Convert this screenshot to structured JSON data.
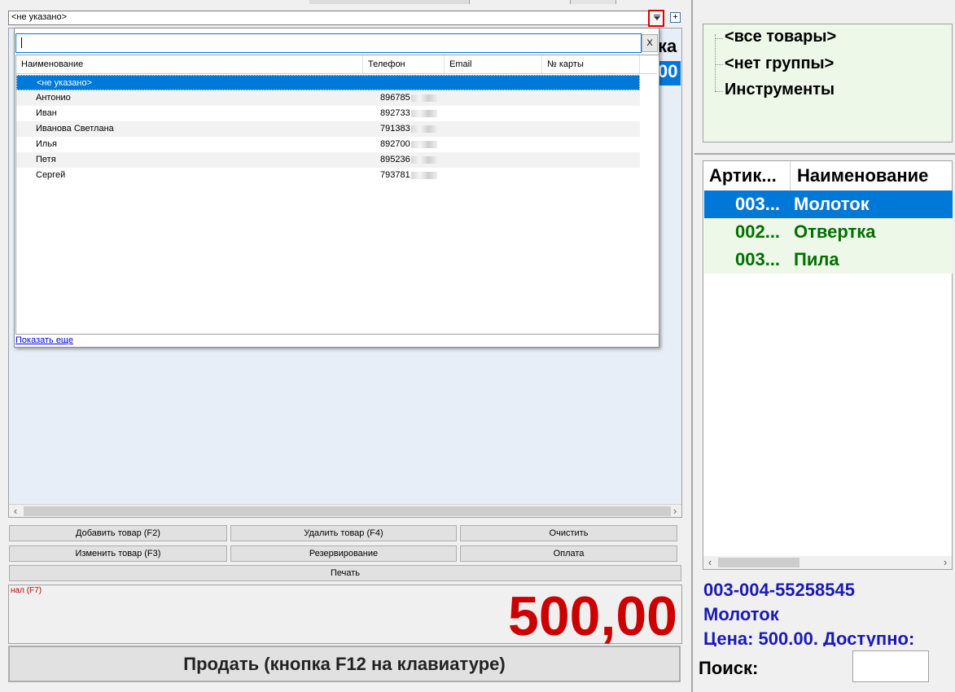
{
  "customer_combo": {
    "value": "<не указано>",
    "add_label": "+"
  },
  "cart_behind": {
    "header_fragment": "ка",
    "row_fragment": "00"
  },
  "popup": {
    "close_label": "X",
    "columns": [
      "Наименование",
      "Телефон",
      "Email",
      "№ карты"
    ],
    "rows": [
      {
        "name": "<не указано>",
        "phone": ""
      },
      {
        "name": "Антонио",
        "phone": "896785"
      },
      {
        "name": "Иван",
        "phone": "892733"
      },
      {
        "name": "Иванова Светлана",
        "phone": "791383"
      },
      {
        "name": "Илья",
        "phone": "892700"
      },
      {
        "name": "Петя",
        "phone": "895236"
      },
      {
        "name": "Сергей",
        "phone": "793781"
      }
    ],
    "show_more": "Показать еще"
  },
  "buttons": {
    "add": "Добавить товар (F2)",
    "remove": "Удалить товар (F4)",
    "clear": "Очистить",
    "edit": "Изменить товар (F3)",
    "reserve": "Резервирование",
    "payment": "Оплата",
    "print": "Печать"
  },
  "payment_method": "нал (F7)",
  "total": "500,00",
  "sell_button": "Продать (кнопка F12 на клавиатуре)",
  "groups": [
    "<все товары>",
    "<нет группы>",
    "Инструменты"
  ],
  "products": {
    "columns": [
      "Артик...",
      "Наименование"
    ],
    "rows": [
      {
        "article": "003...",
        "name": "Молоток",
        "selected": true
      },
      {
        "article": "002...",
        "name": "Отвертка",
        "selected": false
      },
      {
        "article": "003...",
        "name": "Пила",
        "selected": false
      }
    ]
  },
  "details": {
    "article": "003-004-55258545",
    "name": "Молоток",
    "price_line": "Цена: 500.00. Доступно:"
  },
  "search_label": "Поиск:",
  "colors": {
    "selection": "#0078d7",
    "total": "#cc0000",
    "product_text": "#007000",
    "details_text": "#1a1ab4"
  }
}
